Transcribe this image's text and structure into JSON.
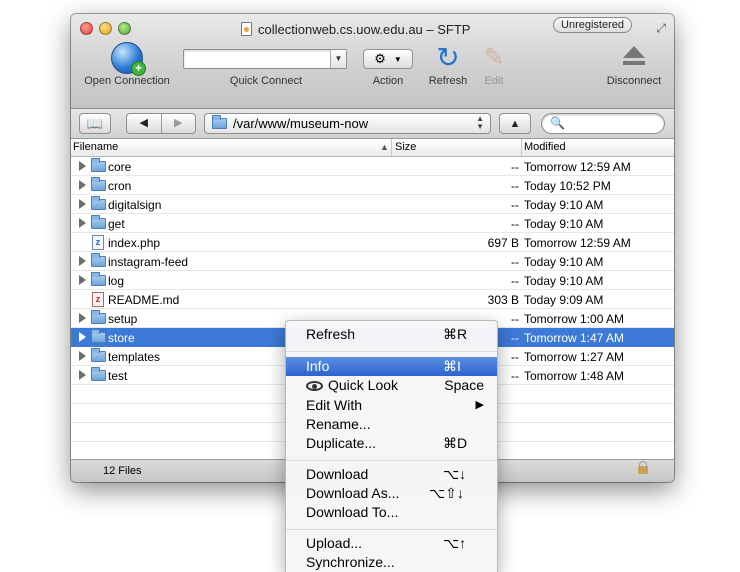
{
  "window": {
    "title": "collectionweb.cs.uow.edu.au – SFTP",
    "badge": "Unregistered"
  },
  "toolbar": {
    "open_connection": "Open Connection",
    "quick_connect": "Quick Connect",
    "action": "Action",
    "refresh": "Refresh",
    "edit": "Edit",
    "disconnect": "Disconnect",
    "quick_connect_value": ""
  },
  "nav": {
    "path": "/var/www/museum-now",
    "search_placeholder": "",
    "up_label": "▲",
    "back_label": "◀",
    "forward_label": "▶"
  },
  "columns": {
    "filename": "Filename",
    "size": "Size",
    "modified": "Modified"
  },
  "files": [
    {
      "name": "core",
      "type": "folder",
      "size": "--",
      "modified": "Tomorrow 12:59 AM"
    },
    {
      "name": "cron",
      "type": "folder",
      "size": "--",
      "modified": "Today 10:52 PM"
    },
    {
      "name": "digitalsign",
      "type": "folder",
      "size": "--",
      "modified": "Today 9:10 AM"
    },
    {
      "name": "get",
      "type": "folder",
      "size": "--",
      "modified": "Today 9:10 AM"
    },
    {
      "name": "index.php",
      "type": "file",
      "size": "697 B",
      "modified": "Tomorrow 12:59 AM"
    },
    {
      "name": "instagram-feed",
      "type": "folder",
      "size": "--",
      "modified": "Today 9:10 AM"
    },
    {
      "name": "log",
      "type": "folder",
      "size": "--",
      "modified": "Today 9:10 AM"
    },
    {
      "name": "README.md",
      "type": "file",
      "size": "303 B",
      "modified": "Today 9:09 AM"
    },
    {
      "name": "setup",
      "type": "folder",
      "size": "--",
      "modified": "Tomorrow 1:00 AM"
    },
    {
      "name": "store",
      "type": "folder",
      "size": "--",
      "modified": "Tomorrow 1:47 AM",
      "selected": true
    },
    {
      "name": "templates",
      "type": "folder",
      "size": "--",
      "modified": "Tomorrow 1:27 AM"
    },
    {
      "name": "test",
      "type": "folder",
      "size": "--",
      "modified": "Tomorrow 1:48 AM"
    }
  ],
  "status": {
    "count": "12 Files"
  },
  "context_menu": {
    "refresh": {
      "label": "Refresh",
      "shortcut": "⌘R"
    },
    "info": {
      "label": "Info",
      "shortcut": "⌘I"
    },
    "quick_look": {
      "label": "Quick Look",
      "shortcut": "Space"
    },
    "edit_with": {
      "label": "Edit With",
      "shortcut": "▶"
    },
    "rename": {
      "label": "Rename..."
    },
    "duplicate": {
      "label": "Duplicate...",
      "shortcut": "⌘D"
    },
    "download": {
      "label": "Download",
      "shortcut": "⌥↓"
    },
    "download_as": {
      "label": "Download As...",
      "shortcut": "⌥⇧↓"
    },
    "download_to": {
      "label": "Download To..."
    },
    "upload": {
      "label": "Upload...",
      "shortcut": "⌥↑"
    },
    "synchronize": {
      "label": "Synchronize..."
    }
  },
  "colors": {
    "selection": "#3d79d6",
    "menu_highlight": "#2d62cf"
  }
}
